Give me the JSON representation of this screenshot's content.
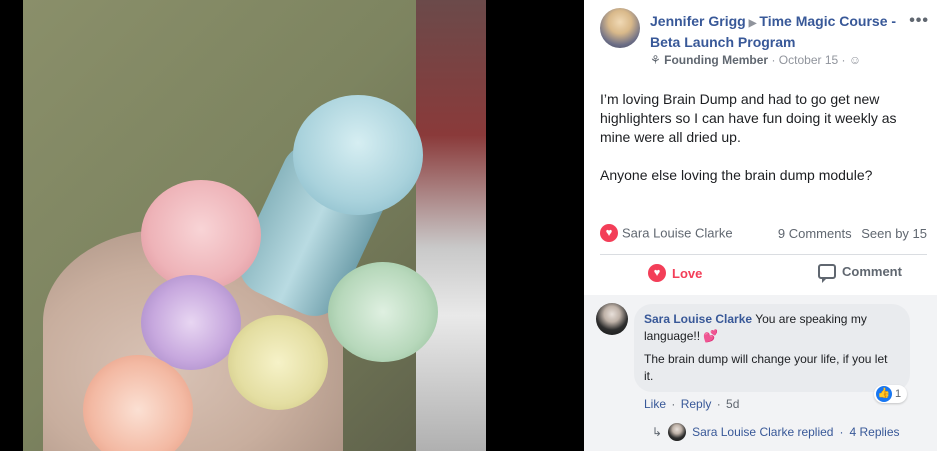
{
  "post": {
    "author": "Jennifer Grigg",
    "group": "Time Magic Course - Beta Launch Program",
    "badge": "Founding Member",
    "date": "October 15",
    "more": "•••",
    "text_p1": "I’m loving Brain Dump and had to go get new highlighters so I can have fun doing it weekly as mine were all dried up.",
    "text_p2": "Anyone else loving the brain dump module?"
  },
  "reactions": {
    "reactor": "Sara Louise Clarke",
    "comments": "9 Comments",
    "seen": "Seen by 15"
  },
  "actions": {
    "love_label": "Love",
    "comment_label": "Comment"
  },
  "comment": {
    "author": "Sara Louise Clarke",
    "text1": "You are speaking my language!!",
    "hearts": "💕",
    "text2": "The brain dump will change your life, if you let it.",
    "like_count": "1",
    "like_label": "Like",
    "reply_label": "Reply",
    "age": "5d"
  },
  "replies": {
    "text": "Sara Louise Clarke replied",
    "count": "4 Replies"
  },
  "colors": {
    "link": "#385898",
    "love": "#f33e58",
    "like": "#1877f2"
  },
  "icons": [
    "arrow-right-icon",
    "more-icon",
    "sprout-icon",
    "globe-icon",
    "heart-icon",
    "comment-icon",
    "like-icon",
    "reply-arrow-icon"
  ]
}
